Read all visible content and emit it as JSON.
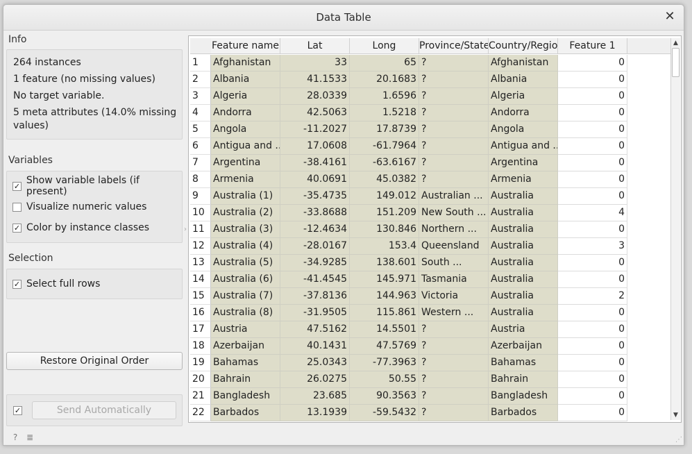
{
  "window": {
    "title": "Data Table"
  },
  "info": {
    "heading": "Info",
    "lines": [
      "264 instances",
      "1 feature (no missing values)",
      "No target variable.",
      "5 meta attributes (14.0% missing",
      "values)"
    ]
  },
  "variables": {
    "heading": "Variables",
    "show_labels": {
      "label": "Show variable labels (if present)",
      "checked": true,
      "mark": "✓"
    },
    "visualize_numeric": {
      "label": "Visualize numeric values",
      "checked": false,
      "mark": ""
    },
    "color_by_class": {
      "label": "Color by instance classes",
      "checked": true,
      "mark": "✓"
    }
  },
  "selection": {
    "heading": "Selection",
    "select_full_rows": {
      "label": "Select full rows",
      "checked": true,
      "mark": "✓"
    }
  },
  "buttons": {
    "restore": "Restore Original Order",
    "send_auto": "Send Automatically",
    "send_auto_checkbox": "✓"
  },
  "table": {
    "columns": [
      "Feature name",
      "Lat",
      "Long",
      "Province/State",
      "Country/Region",
      "Feature 1"
    ],
    "rows": [
      [
        "1",
        "Afghanistan",
        "33",
        "65",
        "?",
        "Afghanistan",
        "0"
      ],
      [
        "2",
        "Albania",
        "41.1533",
        "20.1683",
        "?",
        "Albania",
        "0"
      ],
      [
        "3",
        "Algeria",
        "28.0339",
        "1.6596",
        "?",
        "Algeria",
        "0"
      ],
      [
        "4",
        "Andorra",
        "42.5063",
        "1.5218",
        "?",
        "Andorra",
        "0"
      ],
      [
        "5",
        "Angola",
        "-11.2027",
        "17.8739",
        "?",
        "Angola",
        "0"
      ],
      [
        "6",
        "Antigua and ...",
        "17.0608",
        "-61.7964",
        "?",
        "Antigua and ...",
        "0"
      ],
      [
        "7",
        "Argentina",
        "-38.4161",
        "-63.6167",
        "?",
        "Argentina",
        "0"
      ],
      [
        "8",
        "Armenia",
        "40.0691",
        "45.0382",
        "?",
        "Armenia",
        "0"
      ],
      [
        "9",
        "Australia (1)",
        "-35.4735",
        "149.012",
        "Australian ...",
        "Australia",
        "0"
      ],
      [
        "10",
        "Australia (2)",
        "-33.8688",
        "151.209",
        "New South ...",
        "Australia",
        "4"
      ],
      [
        "11",
        "Australia (3)",
        "-12.4634",
        "130.846",
        "Northern ...",
        "Australia",
        "0"
      ],
      [
        "12",
        "Australia (4)",
        "-28.0167",
        "153.4",
        "Queensland",
        "Australia",
        "3"
      ],
      [
        "13",
        "Australia (5)",
        "-34.9285",
        "138.601",
        "South ...",
        "Australia",
        "0"
      ],
      [
        "14",
        "Australia (6)",
        "-41.4545",
        "145.971",
        "Tasmania",
        "Australia",
        "0"
      ],
      [
        "15",
        "Australia (7)",
        "-37.8136",
        "144.963",
        "Victoria",
        "Australia",
        "2"
      ],
      [
        "16",
        "Australia (8)",
        "-31.9505",
        "115.861",
        "Western ...",
        "Australia",
        "0"
      ],
      [
        "17",
        "Austria",
        "47.5162",
        "14.5501",
        "?",
        "Austria",
        "0"
      ],
      [
        "18",
        "Azerbaijan",
        "40.1431",
        "47.5769",
        "?",
        "Azerbaijan",
        "0"
      ],
      [
        "19",
        "Bahamas",
        "25.0343",
        "-77.3963",
        "?",
        "Bahamas",
        "0"
      ],
      [
        "20",
        "Bahrain",
        "26.0275",
        "50.55",
        "?",
        "Bahrain",
        "0"
      ],
      [
        "21",
        "Bangladesh",
        "23.685",
        "90.3563",
        "?",
        "Bangladesh",
        "0"
      ],
      [
        "22",
        "Barbados",
        "13.1939",
        "-59.5432",
        "?",
        "Barbados",
        "0"
      ]
    ]
  },
  "status": {
    "help_icon": "?",
    "doc_icon": "≣"
  },
  "colors": {
    "meta_cell": "#deddca",
    "window_bg": "#efefef"
  }
}
